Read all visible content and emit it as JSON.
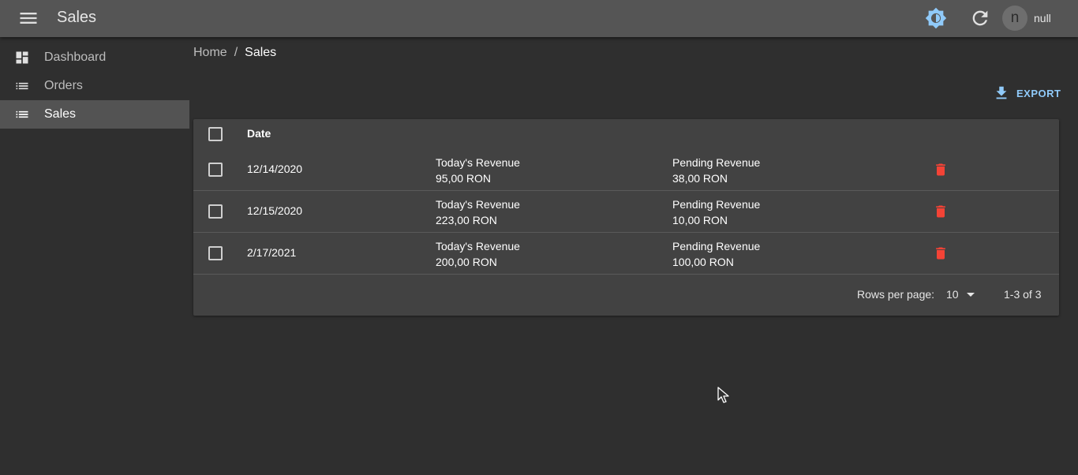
{
  "appbar": {
    "title": "Sales",
    "user_initial": "n",
    "user_name": "null"
  },
  "sidebar": {
    "items": [
      {
        "label": "Dashboard",
        "icon": "dashboard-icon",
        "active": false
      },
      {
        "label": "Orders",
        "icon": "list-icon",
        "active": false
      },
      {
        "label": "Sales",
        "icon": "list-icon",
        "active": true
      }
    ]
  },
  "breadcrumb": {
    "home": "Home",
    "separator": "/",
    "current": "Sales"
  },
  "toolbar": {
    "export_label": "EXPORT"
  },
  "table": {
    "header": {
      "date": "Date"
    },
    "rows": [
      {
        "date": "12/14/2020",
        "revenue_label": "Today's Revenue",
        "revenue": "95,00 RON",
        "pending_label": "Pending Revenue",
        "pending": "38,00 RON"
      },
      {
        "date": "12/15/2020",
        "revenue_label": "Today's Revenue",
        "revenue": "223,00 RON",
        "pending_label": "Pending Revenue",
        "pending": "10,00 RON"
      },
      {
        "date": "2/17/2021",
        "revenue_label": "Today's Revenue",
        "revenue": "200,00 RON",
        "pending_label": "Pending Revenue",
        "pending": "100,00 RON"
      }
    ],
    "pagination": {
      "rows_per_page_label": "Rows per page:",
      "rows_per_page": "10",
      "range": "1-3 of 3"
    }
  },
  "colors": {
    "appbar": "#555555",
    "background": "#2f2f2f",
    "card": "#424242",
    "accent": "#90caf9",
    "delete": "#f44336"
  }
}
